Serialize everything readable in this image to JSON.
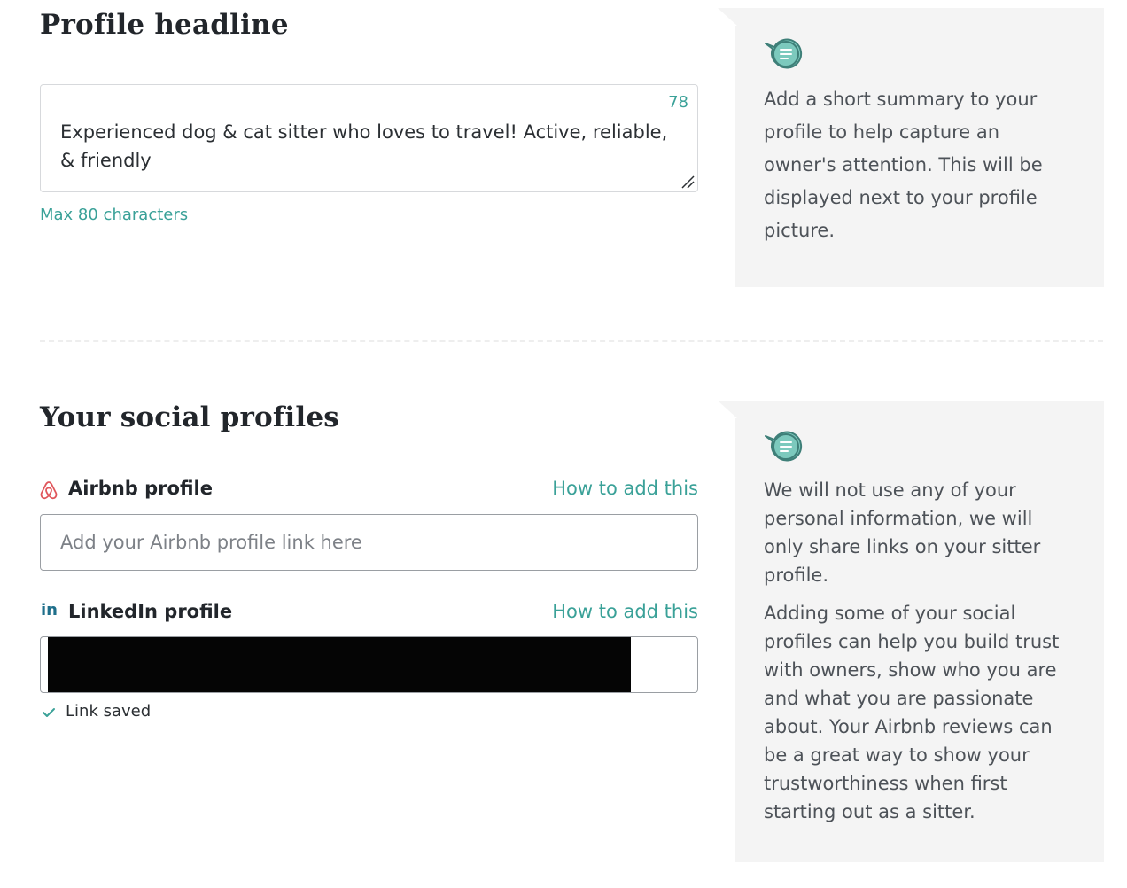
{
  "headline_section": {
    "title": "Profile headline",
    "char_count": "78",
    "value": "Experienced dog & cat sitter who loves to travel! Active, reliable, & friendly",
    "hint": "Max 80 characters",
    "info_text": "Add a short summary to your profile to help capture an owner's attention. This will be displayed next to your profile picture.",
    "info_icon": "speech-bubble-icon"
  },
  "social_section": {
    "title": "Your social profiles",
    "airbnb": {
      "icon": "airbnb-icon",
      "label": "Airbnb profile",
      "help_link": "How to add this",
      "placeholder": "Add your Airbnb profile link here",
      "value": ""
    },
    "linkedin": {
      "icon": "linkedin-icon",
      "label": "LinkedIn profile",
      "help_link": "How to add this",
      "status_icon": "check-icon",
      "status": "Link saved"
    },
    "info_icon": "speech-bubble-icon",
    "info_text_1": "We will not use any of your personal information, we will only share links on your sitter profile.",
    "info_text_2": "Adding some of your social profiles can help you build trust with owners, show who you are and what you are passionate about. Your Airbnb reviews can be a great way to show your trustworthiness when first starting out as a sitter."
  },
  "colors": {
    "accent": "#3aa198",
    "panel_bg": "#f4f4f4",
    "icon_bubble": "#7cc9bd"
  }
}
